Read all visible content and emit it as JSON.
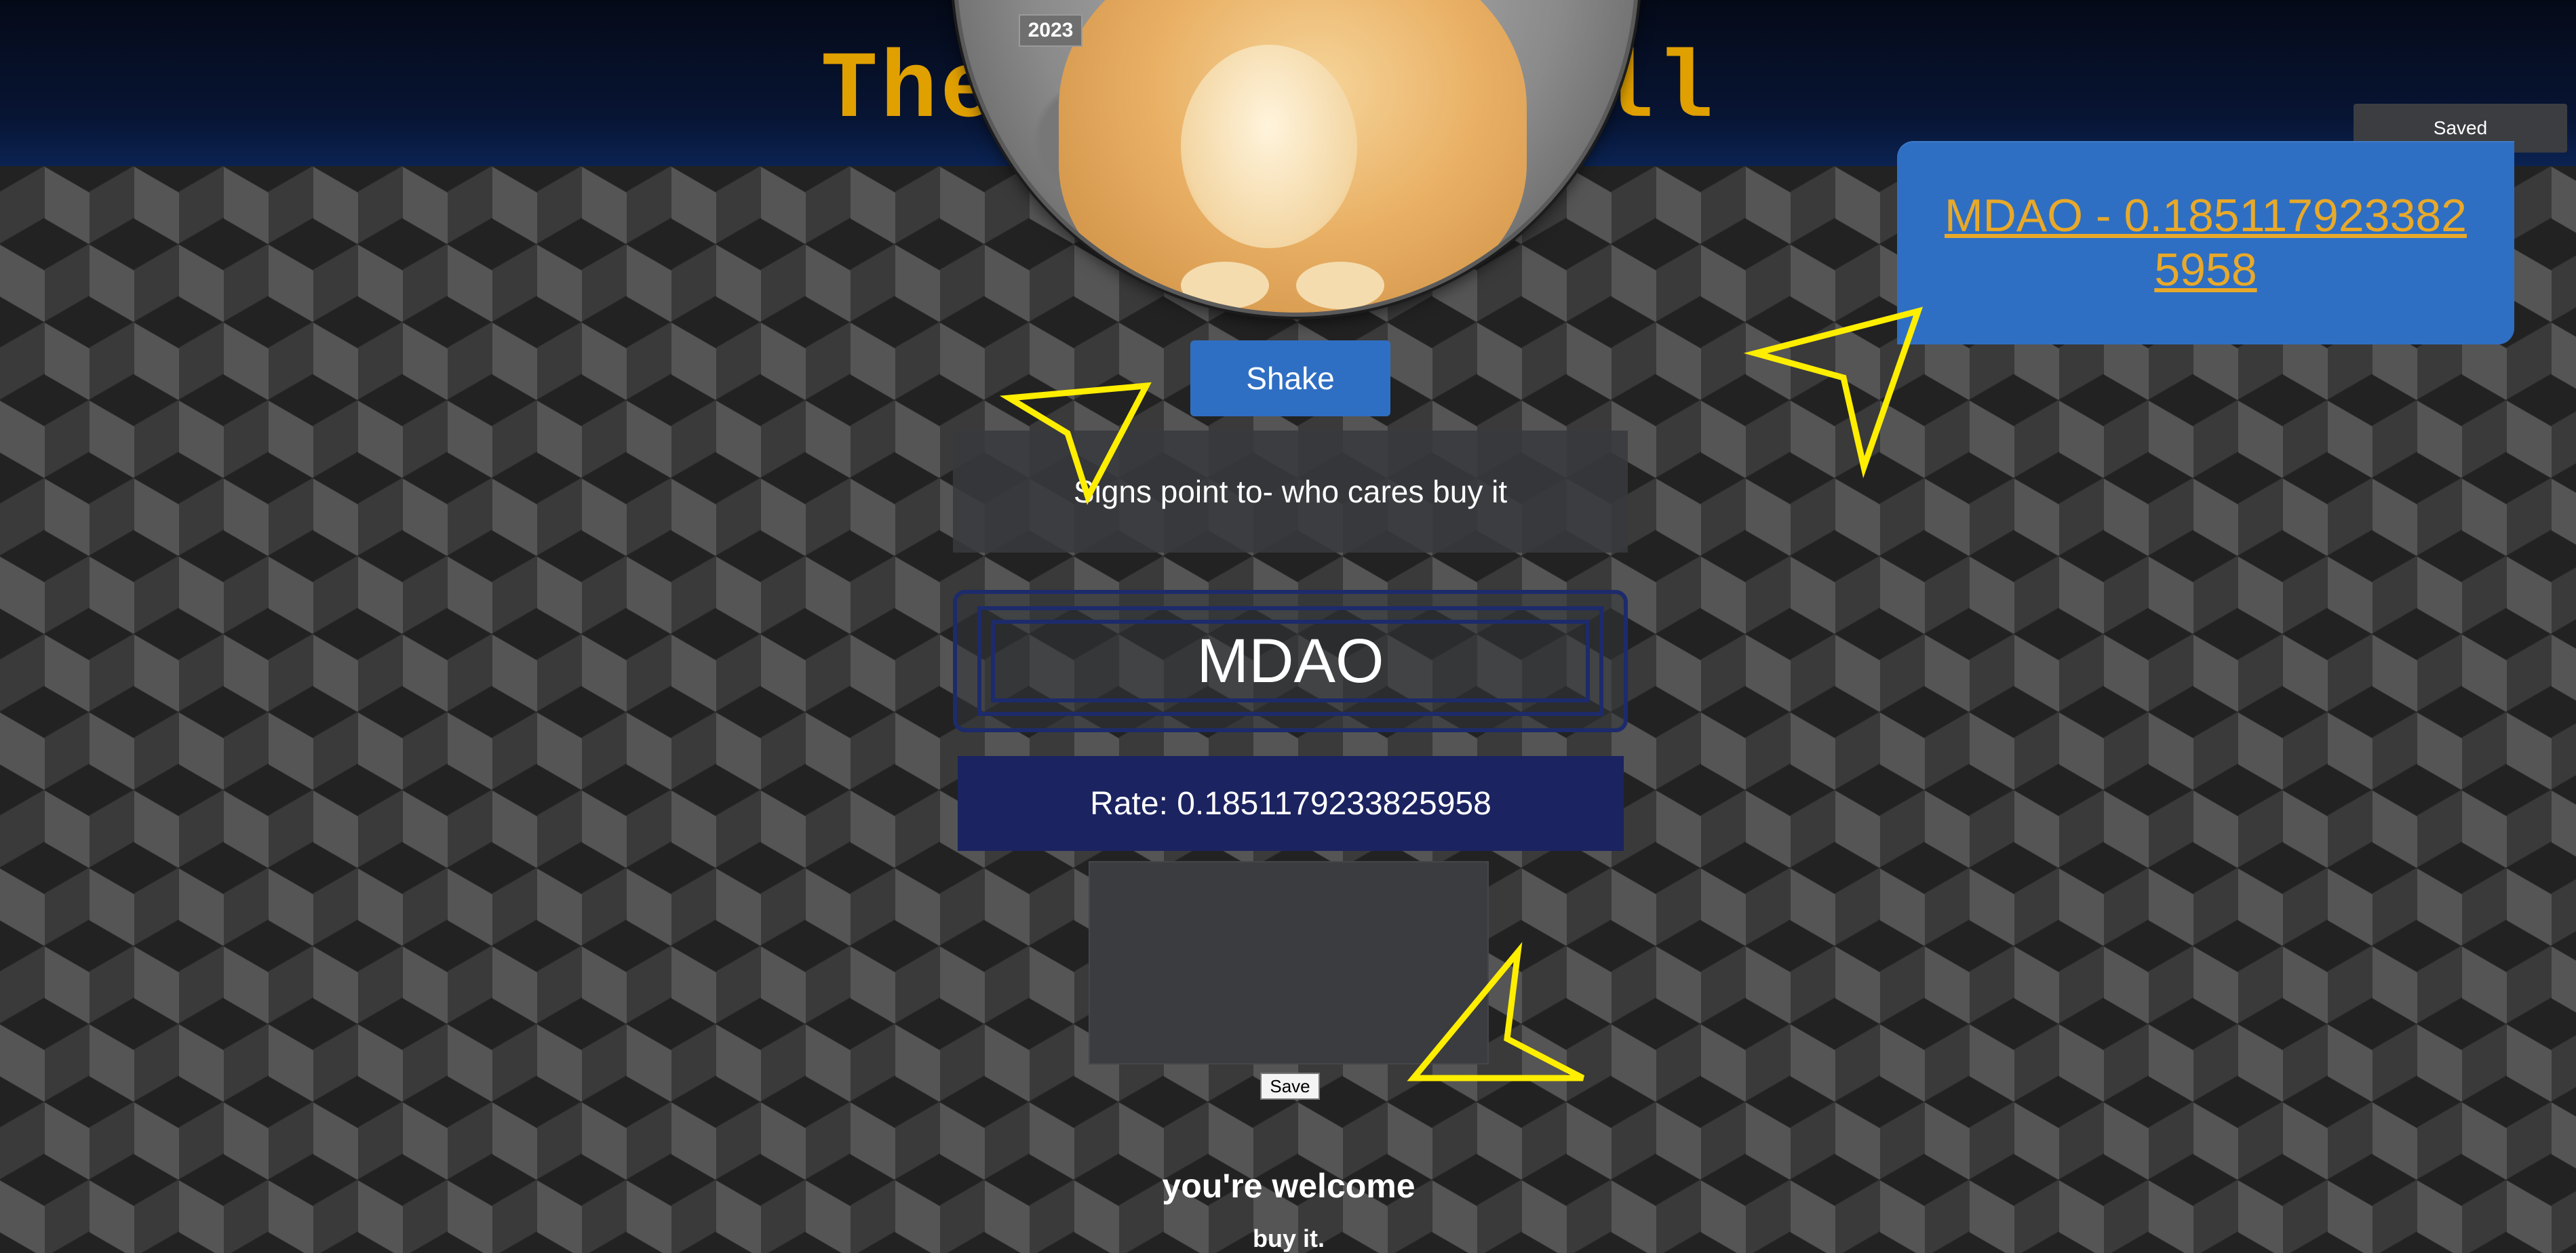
{
  "header": {
    "title": "The Crypto Ball",
    "year_badge": "2023"
  },
  "shake_button": {
    "label": "Shake"
  },
  "answer": {
    "text": "Signs point to- who cares buy it"
  },
  "ticker": {
    "symbol": "MDAO"
  },
  "rate": {
    "text": "Rate: 0.1851179233825958"
  },
  "notes": {
    "value": "",
    "save_label": "Save"
  },
  "footer": {
    "welcome": "you're welcome",
    "tagline": "buy it."
  },
  "saved_indicator": {
    "text": "Saved"
  },
  "coin_card": {
    "link_text": "MDAO - 0.1851179233825958"
  },
  "colors": {
    "accent_gold": "#e0a000",
    "button_blue": "#2f6fc3",
    "rate_navy": "#1b2360",
    "cursor_yellow": "#ffee00"
  },
  "icons": [
    "arrow-cursor-icon"
  ]
}
